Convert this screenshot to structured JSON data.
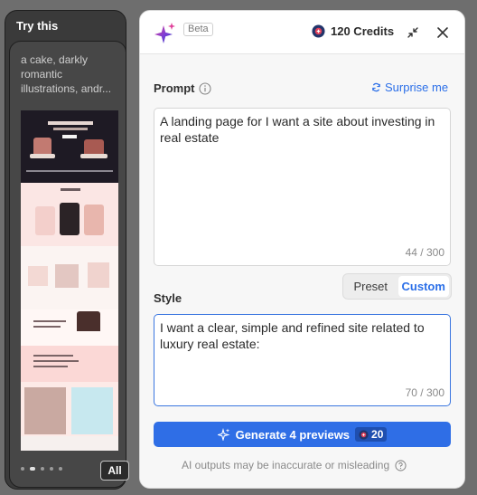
{
  "try_panel": {
    "title": "Try this",
    "description": "a cake, darkly romantic illustrations, andr...",
    "all_label": "All",
    "dots": 5,
    "active_dot": 1
  },
  "dialog": {
    "beta_label": "Beta",
    "credits": "120 Credits",
    "prompt": {
      "label": "Prompt",
      "surprise_label": "Surprise me",
      "value": "A landing page for I want a site about investing in real estate",
      "counter": "44 / 300"
    },
    "style": {
      "label": "Style",
      "options": [
        "Preset",
        "Custom"
      ],
      "selected": "Custom",
      "value": "I want a clear, simple and refined site related to luxury real estate:",
      "counter": "70 / 300"
    },
    "generate": {
      "label": "Generate 4 previews",
      "cost": "20"
    },
    "disclaimer": "AI outputs may be inaccurate or misleading"
  },
  "colors": {
    "accent": "#2f6ee6",
    "link": "#2b6fe8",
    "panel_bg": "#3a3a3a"
  }
}
